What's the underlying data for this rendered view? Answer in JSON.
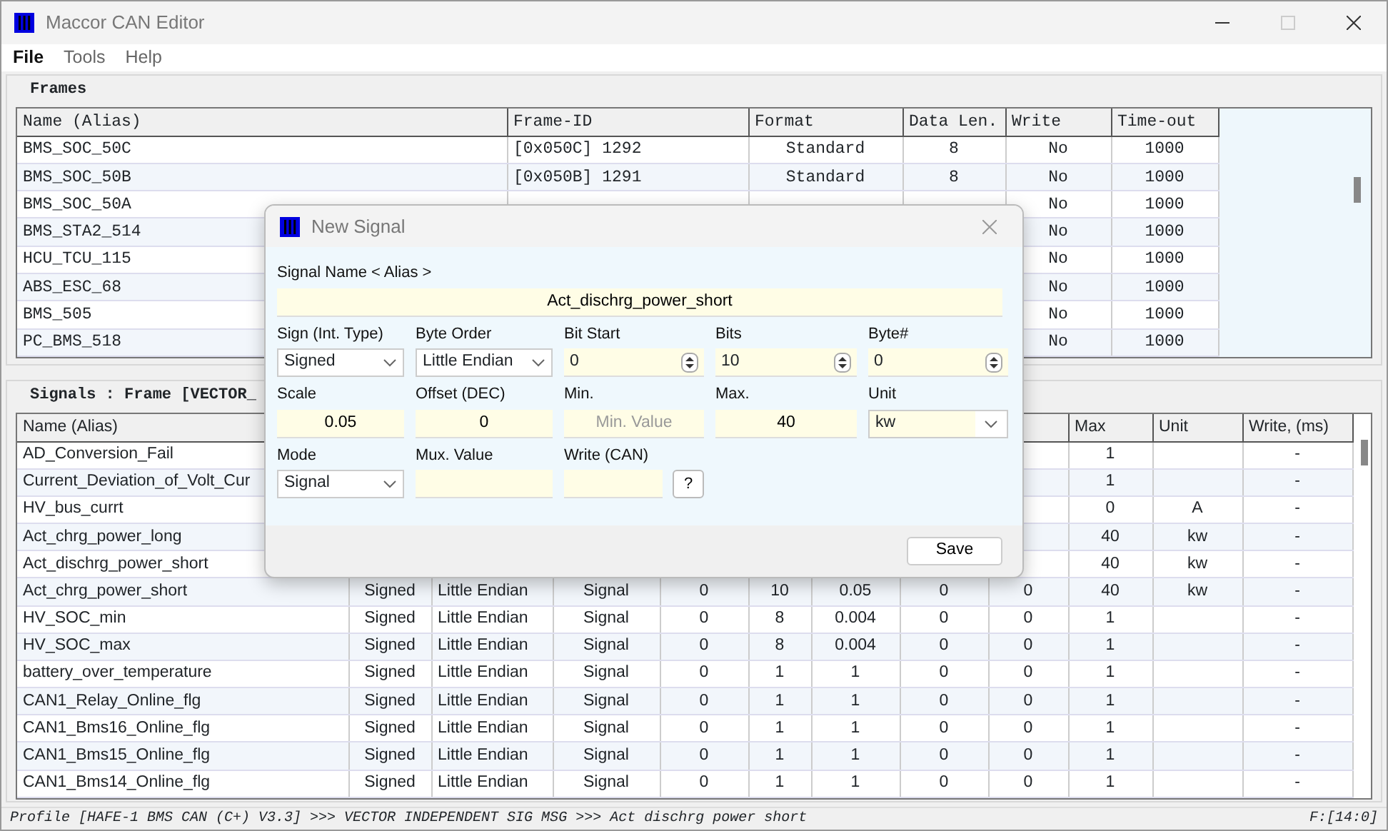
{
  "window": {
    "title": "Maccor CAN Editor"
  },
  "menu": [
    {
      "label": "File",
      "selected": true
    },
    {
      "label": "Tools",
      "selected": false
    },
    {
      "label": "Help",
      "selected": false
    }
  ],
  "frames": {
    "title": "Frames",
    "columns": [
      "Name (Alias)",
      "Frame-ID",
      "Format",
      "Data Len.",
      "Write",
      "Time-out"
    ],
    "rows": [
      [
        "BMS_SOC_50C",
        "[0x050C] 1292",
        "Standard",
        "8",
        "No",
        "1000"
      ],
      [
        "BMS_SOC_50B",
        "[0x050B] 1291",
        "Standard",
        "8",
        "No",
        "1000"
      ],
      [
        "BMS_SOC_50A",
        null,
        null,
        null,
        "No",
        "1000"
      ],
      [
        "BMS_STA2_514",
        null,
        null,
        null,
        "No",
        "1000"
      ],
      [
        "HCU_TCU_115",
        null,
        null,
        null,
        "No",
        "1000"
      ],
      [
        "ABS_ESC_68",
        null,
        null,
        null,
        "No",
        "1000"
      ],
      [
        "BMS_505",
        null,
        null,
        null,
        "No",
        "1000"
      ],
      [
        "PC_BMS_518",
        null,
        null,
        null,
        "No",
        "1000"
      ]
    ]
  },
  "signals": {
    "title": "Signals : Frame [VECTOR_",
    "columns": [
      "Name (Alias)",
      null,
      null,
      null,
      null,
      null,
      null,
      null,
      null,
      "Max",
      "Unit",
      "Write, (ms)"
    ],
    "rows": [
      [
        "AD_Conversion_Fail",
        null,
        null,
        null,
        null,
        null,
        null,
        null,
        null,
        "1",
        null,
        "-"
      ],
      [
        "Current_Deviation_of_Volt_Cur",
        null,
        null,
        null,
        null,
        null,
        null,
        null,
        null,
        "1",
        null,
        "-"
      ],
      [
        "HV_bus_currt",
        null,
        null,
        null,
        null,
        null,
        null,
        null,
        null,
        "0",
        "A",
        "-"
      ],
      [
        "Act_chrg_power_long",
        null,
        null,
        null,
        null,
        null,
        null,
        null,
        null,
        "40",
        "kw",
        "-"
      ],
      [
        "Act_dischrg_power_short",
        null,
        null,
        null,
        null,
        null,
        null,
        null,
        null,
        "40",
        "kw",
        "-"
      ],
      [
        "Act_chrg_power_short",
        "Signed",
        "Little Endian",
        "Signal",
        "0",
        "10",
        "0.05",
        "0",
        "0",
        "40",
        "kw",
        "-"
      ],
      [
        "HV_SOC_min",
        "Signed",
        "Little Endian",
        "Signal",
        "0",
        "8",
        "0.004",
        "0",
        "0",
        "1",
        null,
        "-"
      ],
      [
        "HV_SOC_max",
        "Signed",
        "Little Endian",
        "Signal",
        "0",
        "8",
        "0.004",
        "0",
        "0",
        "1",
        null,
        "-"
      ],
      [
        "battery_over_temperature",
        "Signed",
        "Little Endian",
        "Signal",
        "0",
        "1",
        "1",
        "0",
        "0",
        "1",
        null,
        "-"
      ],
      [
        "CAN1_Relay_Online_flg",
        "Signed",
        "Little Endian",
        "Signal",
        "0",
        "1",
        "1",
        "0",
        "0",
        "1",
        null,
        "-"
      ],
      [
        "CAN1_Bms16_Online_flg",
        "Signed",
        "Little Endian",
        "Signal",
        "0",
        "1",
        "1",
        "0",
        "0",
        "1",
        null,
        "-"
      ],
      [
        "CAN1_Bms15_Online_flg",
        "Signed",
        "Little Endian",
        "Signal",
        "0",
        "1",
        "1",
        "0",
        "0",
        "1",
        null,
        "-"
      ],
      [
        "CAN1_Bms14_Online_flg",
        "Signed",
        "Little Endian",
        "Signal",
        "0",
        "1",
        "1",
        "0",
        "0",
        "1",
        null,
        "-"
      ]
    ]
  },
  "status_bar": {
    "path": "Profile [HAFE-1 BMS CAN (C+) V3.3] >>> VECTOR  INDEPENDENT SIG MSG >>> Act dischrg power short",
    "position": "F:[14:0]"
  },
  "dialog": {
    "title": "New Signal",
    "name_field": {
      "label": "Signal Name < Alias >",
      "value": "Act_dischrg_power_short"
    },
    "rows": [
      [
        {
          "label": "Sign (Int. Type)",
          "kind": "select",
          "value": "Signed"
        },
        {
          "label": "Byte Order",
          "kind": "select",
          "value": "Little Endian"
        },
        {
          "label": "Bit Start",
          "kind": "spin",
          "value": "0"
        },
        {
          "label": "Bits",
          "kind": "spin",
          "value": "10"
        },
        {
          "label": "Byte#",
          "kind": "spin",
          "value": "0"
        }
      ],
      [
        {
          "label": "Scale",
          "kind": "text",
          "value": "0.05"
        },
        {
          "label": "Offset (DEC)",
          "kind": "text",
          "value": "0"
        },
        {
          "label": "Min.",
          "kind": "text",
          "placeholder": "Min. Value"
        },
        {
          "label": "Max.",
          "kind": "text",
          "value": "40"
        },
        {
          "label": "Unit",
          "kind": "combo",
          "value": "kw"
        }
      ],
      [
        {
          "label": "Mode",
          "kind": "select",
          "value": "Signal"
        },
        {
          "label": "Mux. Value",
          "kind": "text"
        },
        {
          "label": "Write (CAN)",
          "kind": "help",
          "button": "?"
        }
      ]
    ],
    "save_button": "Save"
  }
}
